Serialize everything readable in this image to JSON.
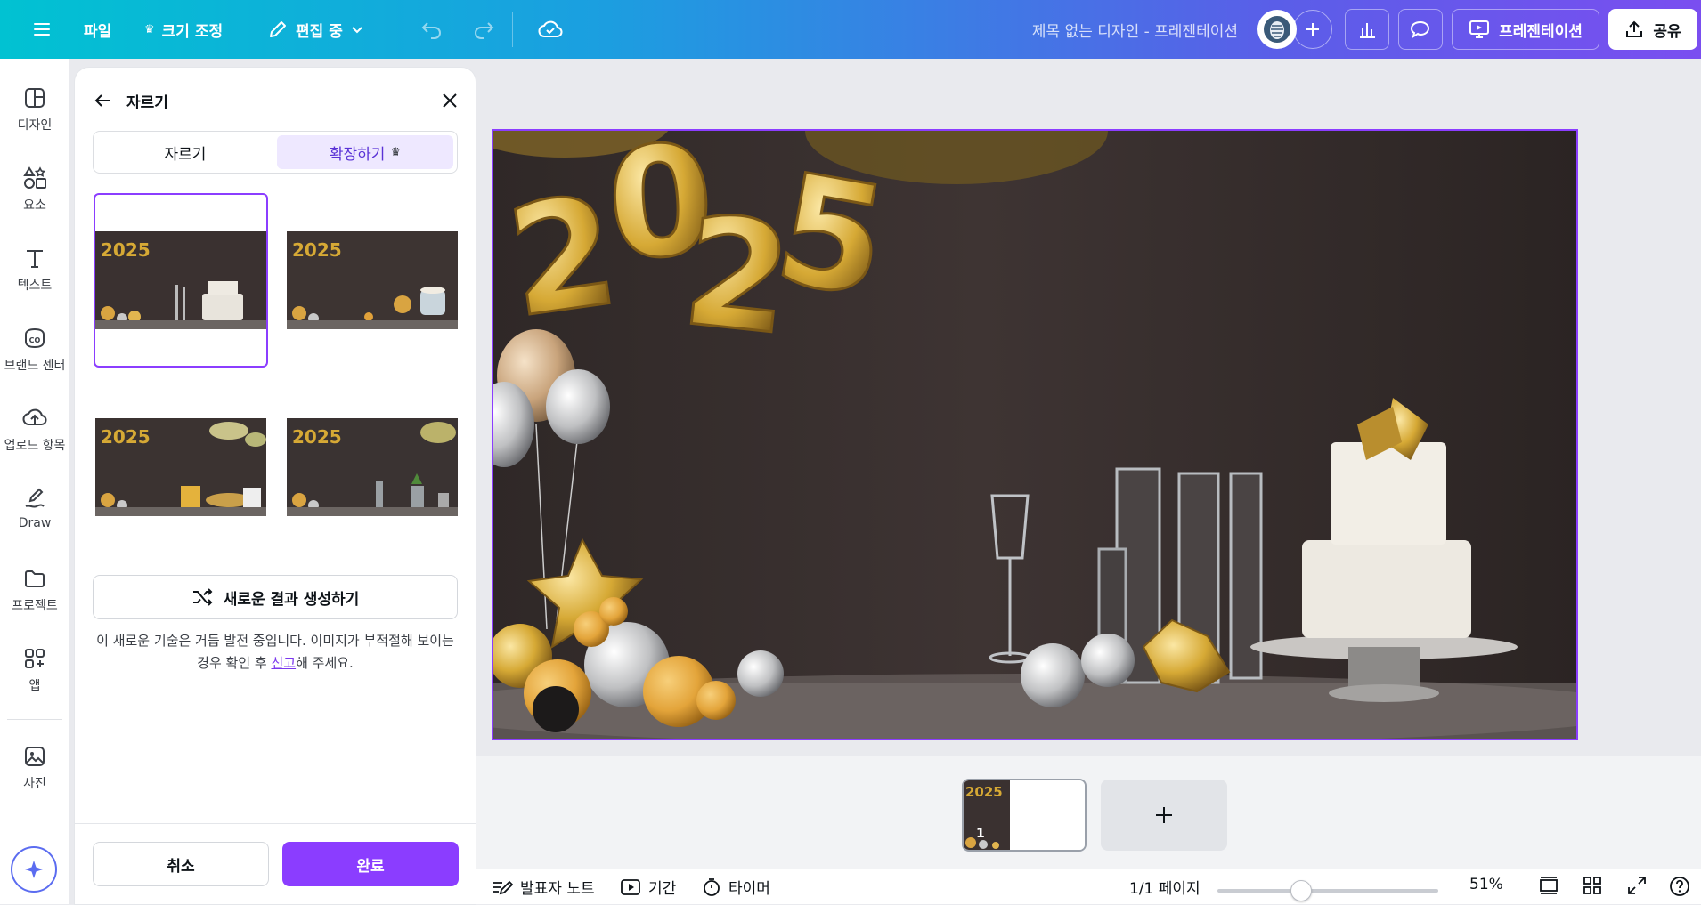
{
  "topbar": {
    "file": "파일",
    "resize": "크기 조정",
    "editing": "편집 중",
    "doc_title": "제목 없는 디자인 - 프레젠테이션",
    "present": "프레젠테이션",
    "share": "공유"
  },
  "rail": {
    "items": [
      {
        "label": "디자인",
        "icon": "layout-icon"
      },
      {
        "label": "요소",
        "icon": "elements-icon"
      },
      {
        "label": "텍스트",
        "icon": "text-icon"
      },
      {
        "label": "브랜드 센터",
        "icon": "brand-icon"
      },
      {
        "label": "업로드 항목",
        "icon": "upload-icon"
      },
      {
        "label": "Draw",
        "icon": "draw-icon"
      },
      {
        "label": "프로젝트",
        "icon": "folder-icon"
      },
      {
        "label": "앱",
        "icon": "apps-icon"
      },
      {
        "label": "사진",
        "icon": "photo-icon"
      }
    ]
  },
  "panel": {
    "title": "자르기",
    "tabs": {
      "crop": "자르기",
      "expand": "확장하기"
    },
    "generate": "새로운 결과 생성하기",
    "note_before": "이 새로운 기술은 거듭 발전 중입니다. 이미지가 부적절해 보이는 경우 확인 후 ",
    "note_link": "신고",
    "note_after": "해 주세요.",
    "cancel": "취소",
    "done": "완료"
  },
  "thumbs": {
    "page_number": "1"
  },
  "bottombar": {
    "notes": "발표자 노트",
    "duration": "기간",
    "timer": "타이머",
    "page_indicator": "1/1 페이지",
    "zoom": "51%",
    "zoom_fraction": 0.38
  },
  "colors": {
    "accent": "#8b3dff",
    "gold": "#d6a935",
    "wall": "#3a3130"
  }
}
